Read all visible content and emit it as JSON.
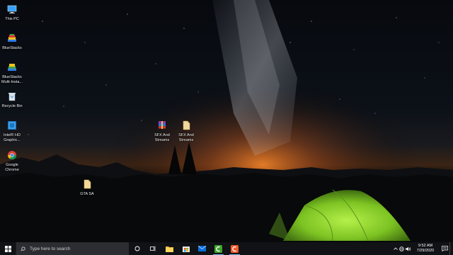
{
  "desktop": {
    "icons": [
      {
        "label": "This PC"
      },
      {
        "label": "BlueStacks"
      },
      {
        "label": "BlueStacks\nMulti-Insta..."
      },
      {
        "label": "Recycle Bin"
      },
      {
        "label": "Intel® HD\nGraphic..."
      },
      {
        "label": "Google\nChrome"
      },
      {
        "label": "SFX And\nStreams"
      },
      {
        "label": "SFX And\nStreams"
      },
      {
        "label": "GTA SA"
      }
    ]
  },
  "taskbar": {
    "search_placeholder": "Type here to search",
    "pinned": [
      {
        "icon": "task-view-icon"
      },
      {
        "icon": "file-explorer-icon"
      },
      {
        "icon": "microsoft-store-icon"
      },
      {
        "icon": "mail-icon"
      },
      {
        "icon": "camtasia-icon"
      },
      {
        "icon": "camtasia-recorder-icon"
      }
    ],
    "tray": {
      "time": "9:52 AM",
      "date": "7/29/2020"
    }
  },
  "colors": {
    "taskbar": "#101216",
    "search_box": "#2b2d31",
    "accent": "#76b9ed",
    "tent": "#8fd63a",
    "horizon_glow": "#ff7a1a"
  }
}
